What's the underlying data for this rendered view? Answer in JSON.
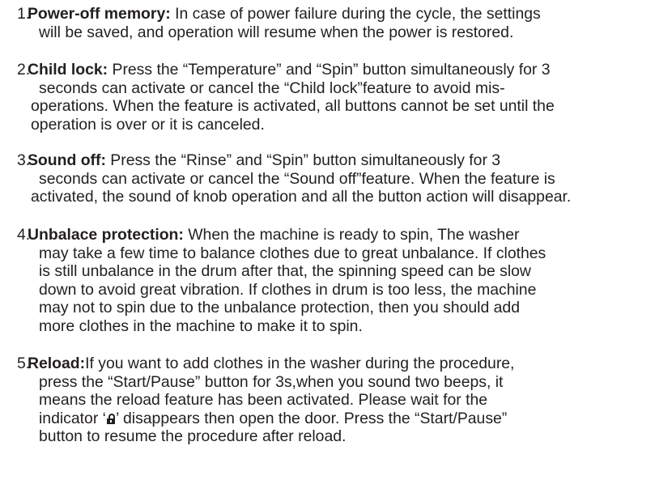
{
  "items": [
    {
      "number": "1.",
      "heading": "Power-off memory:",
      "lines": [
        " In case of power failure during the cycle, the settings",
        "will be saved, and operation will resume when the power is restored."
      ]
    },
    {
      "number": "2.",
      "heading": "Child lock:",
      "lines": [
        " Press the “Temperature” and “Spin” button simultaneously for 3",
        "seconds can activate or cancel the “Child lock”feature to avoid mis-",
        "operations. When the feature is activated, all buttons cannot be set until the",
        "operation is over or it is canceled."
      ]
    },
    {
      "number": "3.",
      "heading": "Sound off:",
      "lines": [
        " Press the “Rinse” and “Spin” button simultaneously for 3",
        "seconds can activate or cancel the “Sound off”feature. When the feature is",
        "activated, the sound of knob operation and all the button action will disappear."
      ]
    },
    {
      "number": "4.",
      "heading": "Unbalace protection:",
      "lines": [
        " When the machine is ready to spin, The washer",
        "may take a few time to balance clothes due to great unbalance. If clothes",
        "is still unbalance in the drum after that, the spinning speed can be slow",
        "down to avoid great vibration. If clothes in drum is too less, the machine",
        "may not to spin due to the unbalance protection, then you should add",
        "more clothes in the machine to make it to spin."
      ]
    },
    {
      "number": "5.",
      "heading": "Reload:",
      "lines": [
        "If you want to add clothes in the washer during the procedure,",
        "press the “Start/Pause” button for 3s,when you sound two beeps, it",
        "means the reload feature has been activated. Please wait for the",
        "indicator ‘",
        "’ disappears then open the door. Press the “Start/Pause”",
        "button to resume the procedure after reload."
      ],
      "icon": "lock-icon"
    }
  ]
}
